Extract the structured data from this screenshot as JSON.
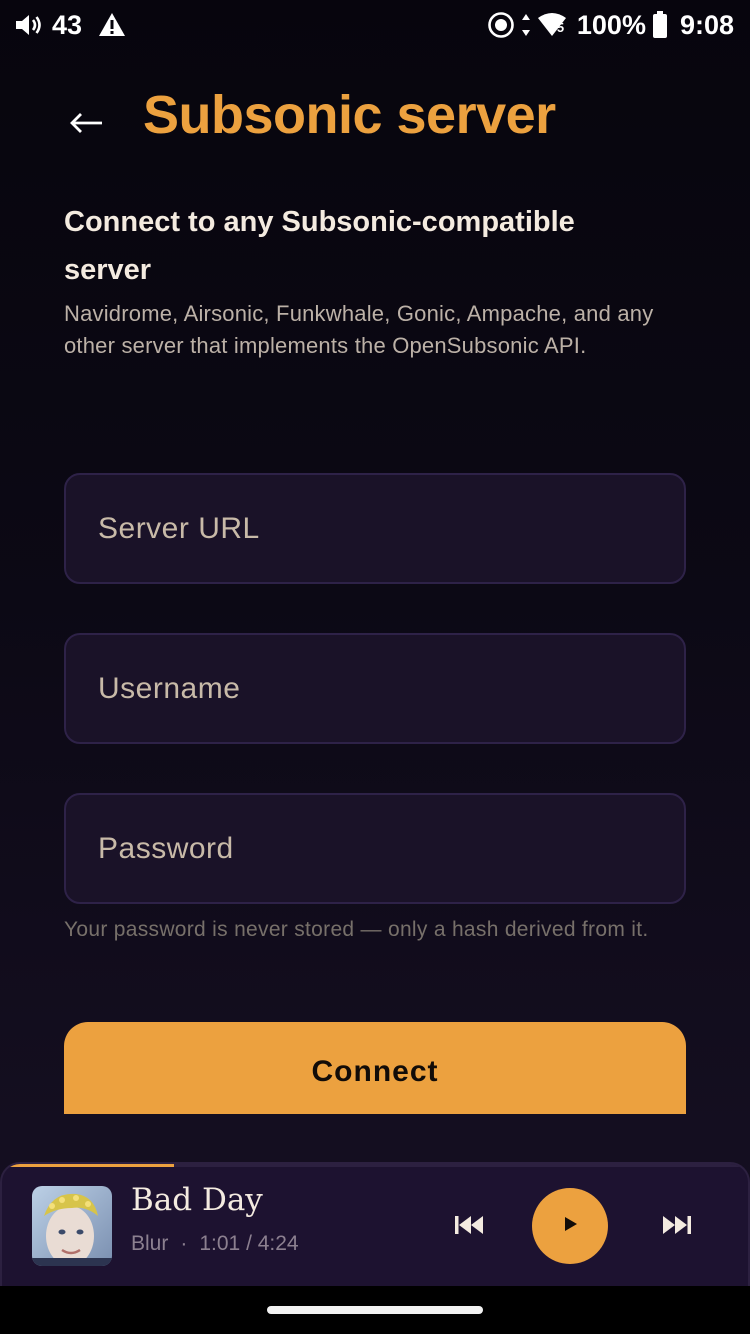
{
  "status_bar": {
    "volume_level": "43",
    "battery": "100%",
    "time": "9:08",
    "icons": [
      "volume-icon",
      "warning-icon",
      "hotspot-icon",
      "data-arrows-icon",
      "wifi-icon",
      "battery-icon"
    ],
    "wifi_badge": "5"
  },
  "header": {
    "title": "Subsonic server",
    "back_icon": "arrow-left-icon"
  },
  "intro": {
    "heading": "Connect to any Subsonic-compatible server",
    "description": "Navidrome, Airsonic, Funkwhale, Gonic, Ampache, and any other server that implements the OpenSubsonic API."
  },
  "form": {
    "server_url": {
      "placeholder": "Server URL",
      "value": ""
    },
    "username": {
      "placeholder": "Username",
      "value": ""
    },
    "password": {
      "placeholder": "Password",
      "value": ""
    },
    "password_hint": "Your password is never stored — only a hash derived from it.",
    "connect_label": "Connect"
  },
  "mini_player": {
    "title": "Bad Day",
    "artist": "Blur",
    "separator": "·",
    "position": "1:01",
    "duration": "4:24",
    "time_display": "1:01 / 4:24",
    "progress": 0.23,
    "icons": [
      "skip-previous-icon",
      "play-icon",
      "skip-next-icon"
    ]
  },
  "colors": {
    "accent": "#eca13f",
    "background": "#0c0915",
    "field_background": "#1a1228",
    "field_border": "#2e2248",
    "player_background": "#1d1230"
  }
}
